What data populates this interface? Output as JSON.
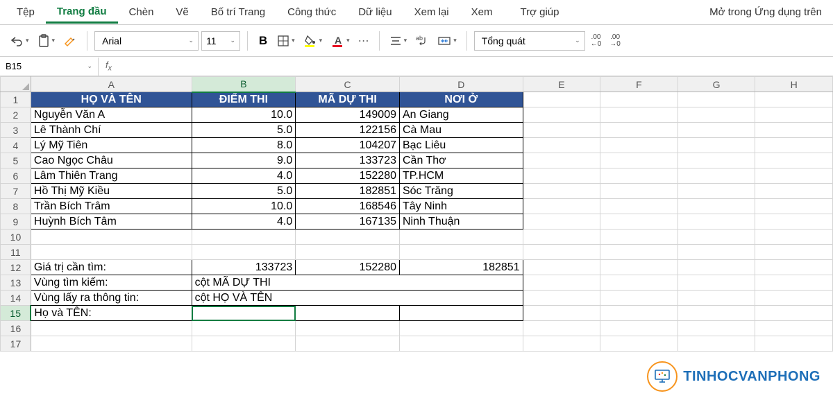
{
  "tabs": [
    "Tệp",
    "Trang đầu",
    "Chèn",
    "Vẽ",
    "Bố trí Trang",
    "Công thức",
    "Dữ liệu",
    "Xem lại",
    "Xem",
    "Trợ giúp"
  ],
  "active_tab": 1,
  "open_in_app": "Mở trong Ứng dụng trên",
  "font_name": "Arial",
  "font_size": "11",
  "number_format": "Tổng quát",
  "namebox": "B15",
  "formula": "",
  "col_headers": [
    "A",
    "B",
    "C",
    "D",
    "E",
    "F",
    "G",
    "H"
  ],
  "col_widths": [
    "col-A",
    "col-B",
    "col-C",
    "col-D",
    "col-E",
    "col-F",
    "col-G",
    "col-H"
  ],
  "selected_col_idx": 1,
  "selected_row": 15,
  "rows": [
    {
      "n": 1,
      "cells": [
        {
          "t": "HỌ VÀ TÊN",
          "cls": "hdr"
        },
        {
          "t": "ĐIỂM THI",
          "cls": "hdr"
        },
        {
          "t": "MÃ DỰ THI",
          "cls": "hdr"
        },
        {
          "t": "NƠI Ở",
          "cls": "hdr"
        },
        {
          "e": 4
        }
      ]
    },
    {
      "n": 2,
      "cells": [
        {
          "t": "Nguyễn Văn A",
          "cls": "data"
        },
        {
          "t": "10.0",
          "cls": "data num"
        },
        {
          "t": "149009",
          "cls": "data num"
        },
        {
          "t": "An Giang",
          "cls": "data"
        },
        {
          "e": 4
        }
      ]
    },
    {
      "n": 3,
      "cells": [
        {
          "t": "Lê Thành Chí",
          "cls": "data"
        },
        {
          "t": "5.0",
          "cls": "data num"
        },
        {
          "t": "122156",
          "cls": "data num"
        },
        {
          "t": "Cà Mau",
          "cls": "data"
        },
        {
          "e": 4
        }
      ]
    },
    {
      "n": 4,
      "cells": [
        {
          "t": "Lý Mỹ Tiên",
          "cls": "data"
        },
        {
          "t": "8.0",
          "cls": "data num"
        },
        {
          "t": "104207",
          "cls": "data num"
        },
        {
          "t": "Bạc Liêu",
          "cls": "data"
        },
        {
          "e": 4
        }
      ]
    },
    {
      "n": 5,
      "cells": [
        {
          "t": "Cao Ngọc Châu",
          "cls": "data"
        },
        {
          "t": "9.0",
          "cls": "data num"
        },
        {
          "t": "133723",
          "cls": "data num"
        },
        {
          "t": "Cần Thơ",
          "cls": "data"
        },
        {
          "e": 4
        }
      ]
    },
    {
      "n": 6,
      "cells": [
        {
          "t": "Lâm Thiên Trang",
          "cls": "data"
        },
        {
          "t": "4.0",
          "cls": "data num"
        },
        {
          "t": "152280",
          "cls": "data num"
        },
        {
          "t": "TP.HCM",
          "cls": "data"
        },
        {
          "e": 4
        }
      ]
    },
    {
      "n": 7,
      "cells": [
        {
          "t": "Hồ Thị Mỹ Kiều",
          "cls": "data"
        },
        {
          "t": "5.0",
          "cls": "data num"
        },
        {
          "t": "182851",
          "cls": "data num"
        },
        {
          "t": "Sóc Trăng",
          "cls": "data"
        },
        {
          "e": 4
        }
      ]
    },
    {
      "n": 8,
      "cells": [
        {
          "t": "Trần Bích Trâm",
          "cls": "data"
        },
        {
          "t": "10.0",
          "cls": "data num"
        },
        {
          "t": "168546",
          "cls": "data num"
        },
        {
          "t": "Tây Ninh",
          "cls": "data"
        },
        {
          "e": 4
        }
      ]
    },
    {
      "n": 9,
      "cells": [
        {
          "t": "Huỳnh Bích Tâm",
          "cls": "data"
        },
        {
          "t": "4.0",
          "cls": "data num"
        },
        {
          "t": "167135",
          "cls": "data num"
        },
        {
          "t": "Ninh Thuận",
          "cls": "data"
        },
        {
          "e": 4
        }
      ]
    },
    {
      "n": 10,
      "cells": [
        {
          "e": 8
        }
      ]
    },
    {
      "n": 11,
      "cells": [
        {
          "e": 8
        }
      ]
    },
    {
      "n": 12,
      "cells": [
        {
          "t": "Giá trị cần tìm:",
          "cls": "data"
        },
        {
          "t": "133723",
          "cls": "data num"
        },
        {
          "t": "152280",
          "cls": "data num"
        },
        {
          "t": "182851",
          "cls": "data num"
        },
        {
          "e": 4
        }
      ]
    },
    {
      "n": 13,
      "cells": [
        {
          "t": "Vùng tìm kiếm:",
          "cls": "data"
        },
        {
          "t": "cột MÃ DỰ THI",
          "cls": "data",
          "span": 3
        },
        {
          "e": 4
        }
      ]
    },
    {
      "n": 14,
      "cells": [
        {
          "t": "Vùng lấy ra thông tin:",
          "cls": "data"
        },
        {
          "t": "cột HỌ VÀ TÊN",
          "cls": "data",
          "span": 3
        },
        {
          "e": 4
        }
      ]
    },
    {
      "n": 15,
      "cells": [
        {
          "t": "Họ và TÊN:",
          "cls": "data"
        },
        {
          "t": "",
          "cls": "data sel-cell"
        },
        {
          "t": "",
          "cls": "data"
        },
        {
          "t": "",
          "cls": "data"
        },
        {
          "e": 4
        }
      ]
    },
    {
      "n": 16,
      "cells": [
        {
          "e": 8
        }
      ]
    },
    {
      "n": 17,
      "cells": [
        {
          "e": 8
        }
      ]
    }
  ],
  "watermark": "TINHOCVANPHONG"
}
